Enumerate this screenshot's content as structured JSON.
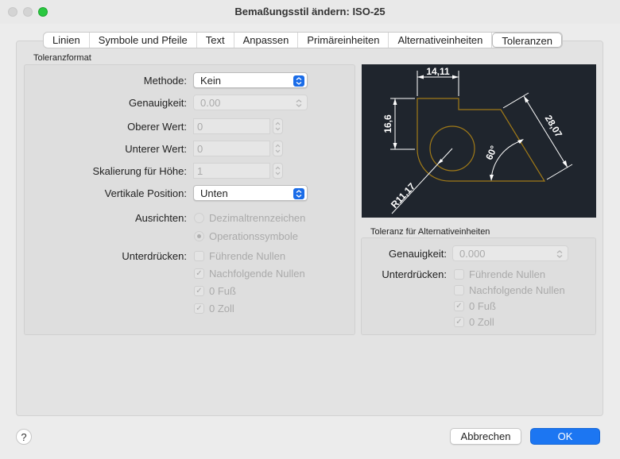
{
  "window": {
    "title": "Bemaßungsstil ändern: ISO-25"
  },
  "tabs": [
    {
      "label": "Linien"
    },
    {
      "label": "Symbole und Pfeile"
    },
    {
      "label": "Text"
    },
    {
      "label": "Anpassen"
    },
    {
      "label": "Primäreinheiten"
    },
    {
      "label": "Alternativeinheiten"
    },
    {
      "label": "Toleranzen",
      "active": true
    }
  ],
  "tolerance_format": {
    "group_label": "Toleranzformat",
    "method": {
      "label": "Methode:",
      "value": "Kein"
    },
    "precision": {
      "label": "Genauigkeit:",
      "value": "0.00"
    },
    "upper": {
      "label": "Oberer Wert:",
      "value": "0"
    },
    "lower": {
      "label": "Unterer Wert:",
      "value": "0"
    },
    "scale": {
      "label": "Skalierung für Höhe:",
      "value": "1"
    },
    "vertical_position": {
      "label": "Vertikale Position:",
      "value": "Unten"
    },
    "align": {
      "label": "Ausrichten:",
      "options": [
        "Dezimaltrennzeichen",
        "Operationssymbole"
      ],
      "selected": 1
    },
    "suppress": {
      "label": "Unterdrücken:",
      "items": [
        {
          "label": "Führende Nullen",
          "checked": false
        },
        {
          "label": "Nachfolgende Nullen",
          "checked": true
        },
        {
          "label": "0 Fuß",
          "checked": true
        },
        {
          "label": "0 Zoll",
          "checked": true
        }
      ]
    }
  },
  "preview": {
    "dim_top": "14,11",
    "dim_left": "16,6",
    "dim_diag": "28,07",
    "dim_angle": "60°",
    "dim_radius": "R11,17",
    "colors": {
      "background": "#1f252d",
      "geometry": "#a07a18",
      "dimension": "#ffffff"
    }
  },
  "alt_tolerance": {
    "group_label": "Toleranz für Alternativeinheiten",
    "precision": {
      "label": "Genauigkeit:",
      "value": "0.000"
    },
    "suppress": {
      "label": "Unterdrücken:",
      "items": [
        {
          "label": "Führende Nullen",
          "checked": false
        },
        {
          "label": "Nachfolgende Nullen",
          "checked": false
        },
        {
          "label": "0 Fuß",
          "checked": true
        },
        {
          "label": "0 Zoll",
          "checked": true
        }
      ]
    }
  },
  "buttons": {
    "help": "?",
    "cancel": "Abbrechen",
    "ok": "OK"
  },
  "check_glyph": "✓",
  "colors": {
    "accent": "#1c76f2"
  }
}
